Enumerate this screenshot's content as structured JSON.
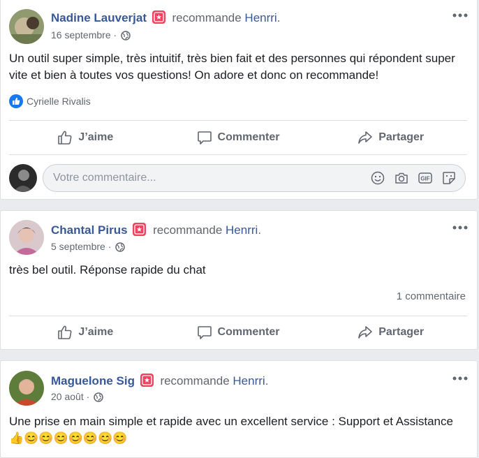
{
  "posts": [
    {
      "author": "Nadine Lauverjat",
      "recommends": "recommande",
      "page": "Henrri",
      "date": "16 septembre",
      "text": "Un outil super simple, très intuitif, très bien fait et des personnes qui répondent super vite et bien à toutes vos questions! On adore et donc on recommande!",
      "liked_by": "Cyrielle Rivalis"
    },
    {
      "author": "Chantal Pirus",
      "recommends": "recommande",
      "page": "Henrri",
      "date": "5 septembre",
      "text": "très bel outil. Réponse rapide du chat",
      "comment_count": "1 commentaire"
    },
    {
      "author": "Maguelone Sig",
      "recommends": "recommande",
      "page": "Henrri",
      "date": "20 août",
      "text": "Une prise en main simple et rapide avec un excellent service : Support et Assistance",
      "emojis": "👍😊😊😊😊😊😊😊"
    }
  ],
  "actions": {
    "like": "J’aime",
    "comment": "Commenter",
    "share": "Partager"
  },
  "composer": {
    "placeholder": "Votre commentaire..."
  },
  "colors": {
    "link": "#385898",
    "badge": "#f3425f",
    "like_blue": "#1877f2"
  }
}
